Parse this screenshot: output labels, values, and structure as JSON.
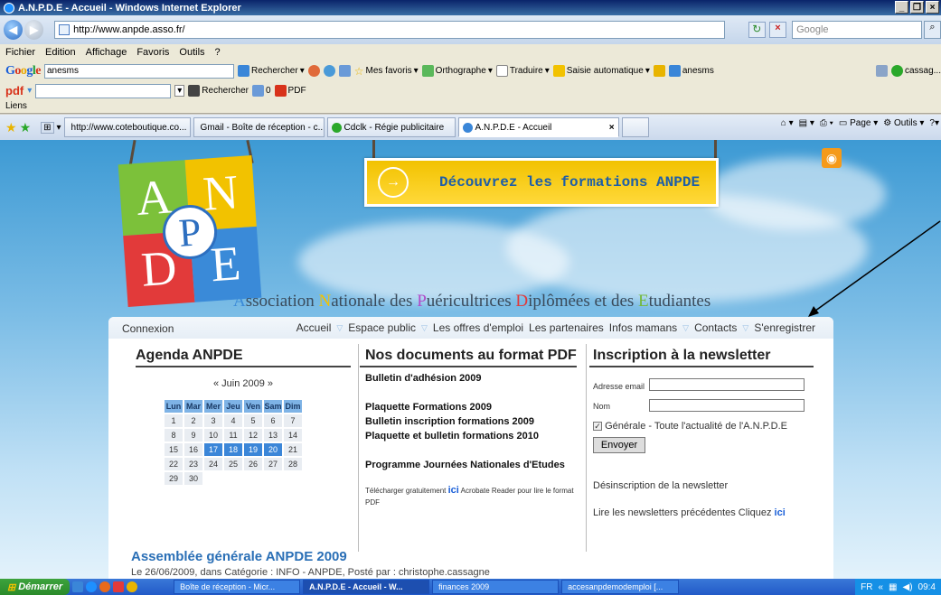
{
  "window": {
    "title": "A.N.P.D.E - Accueil - Windows Internet Explorer"
  },
  "address": {
    "url": "http://www.anpde.asso.fr/",
    "search_placeholder": "Google"
  },
  "menu": [
    "Fichier",
    "Edition",
    "Affichage",
    "Favoris",
    "Outils",
    "?"
  ],
  "google_toolbar": {
    "logo": "Google",
    "query": "anesms",
    "search_label": "Rechercher",
    "favoris": "Mes favoris",
    "ortho": "Orthographe",
    "traduire": "Traduire",
    "saisie": "Saisie automatique",
    "anesms2": "anesms",
    "user": "cassag..."
  },
  "pdf_toolbar": {
    "logo": "pdf",
    "search_label": "Rechercher",
    "count": "0",
    "pdf_label": "PDF"
  },
  "liens": "Liens",
  "tabs": [
    "http://www.coteboutique.co...",
    "Gmail - Boîte de réception - c...",
    "Cdclk - Régie publicitaire",
    "A.N.P.D.E - Accueil"
  ],
  "tab_tools": {
    "page": "Page",
    "outils": "Outils"
  },
  "site": {
    "banner": "Découvrez les formations ANPDE",
    "logo_letters": [
      "A",
      "N",
      "P",
      "D",
      "E"
    ],
    "assoc": {
      "a": "A",
      "a_rest": "ssociation ",
      "n": "N",
      "n_rest": "ationale des ",
      "p": "P",
      "p_rest": "uéricultrices ",
      "d": "D",
      "d_rest": "iplômées et des ",
      "e": "E",
      "e_rest": "tudiantes"
    },
    "nav": {
      "connexion": "Connexion",
      "links": [
        "Accueil",
        "Espace public",
        "Les offres d'emploi",
        "Les partenaires",
        "Infos mamans",
        "Contacts",
        "S'enregistrer"
      ]
    },
    "agenda": {
      "title": "Agenda ANPDE",
      "month": "« Juin 2009 »",
      "days": [
        "Lun",
        "Mar",
        "Mer",
        "Jeu",
        "Ven",
        "Sam",
        "Dim"
      ],
      "weeks": [
        [
          "1",
          "2",
          "3",
          "4",
          "5",
          "6",
          "7"
        ],
        [
          "8",
          "9",
          "10",
          "11",
          "12",
          "13",
          "14"
        ],
        [
          "15",
          "16",
          "17",
          "18",
          "19",
          "20",
          "21"
        ],
        [
          "22",
          "23",
          "24",
          "25",
          "26",
          "27",
          "28"
        ],
        [
          "29",
          "30",
          "",
          "",
          "",
          "",
          ""
        ]
      ]
    },
    "docs": {
      "title": "Nos documents au format PDF",
      "items": [
        "Bulletin d'adhésion 2009",
        "Plaquette Formations 2009",
        "Bulletin inscription formations 2009",
        "Plaquette et bulletin formations 2010",
        "Programme Journées Nationales d'Etudes"
      ],
      "reader_pre": "Télécharger gratuitement ",
      "reader_ici": "ici",
      "reader_post": " Acrobate Reader pour lire le format PDF"
    },
    "newsletter": {
      "title": "Inscription à la newsletter",
      "email_label": "Adresse email",
      "nom_label": "Nom",
      "option": "Générale - Toute l'actualité de l'A.N.P.D.E",
      "button": "Envoyer",
      "unsubscribe": "Désinscription de la newsletter",
      "previous": "Lire les newsletters précédentes Cliquez ",
      "previous_ici": "ici"
    },
    "article": {
      "title": "Assemblée générale ANPDE 2009",
      "meta": "Le 26/06/2009, dans Catégorie : INFO - ANPDE, Posté par : christophe.cassagne"
    }
  },
  "taskbar": {
    "start": "Démarrer",
    "tasks": [
      "Boîte de réception - Micr...",
      "A.N.P.D.E - Accueil - W...",
      "finances 2009",
      "accesanpdemodemploi [..."
    ],
    "lang": "FR",
    "time": "09:4"
  }
}
